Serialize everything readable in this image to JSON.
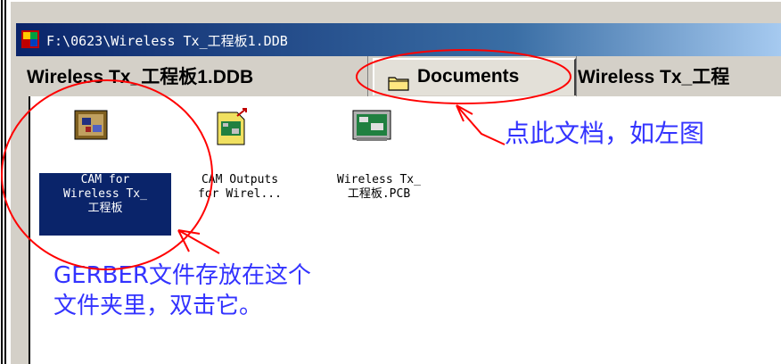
{
  "window": {
    "title": "F:\\0623\\Wireless Tx_工程板1.DDB"
  },
  "tabs": [
    {
      "label": "Wireless Tx_工程板1.DDB",
      "active": false
    },
    {
      "label": "Documents",
      "active": true,
      "icon": "folder-icon"
    },
    {
      "label": "Wireless Tx_工程",
      "active": false
    }
  ],
  "files": [
    {
      "label": "CAM for\nWireless Tx_\n工程板",
      "icon": "cam-folder-icon",
      "selected": true
    },
    {
      "label": "CAM Outputs\nfor Wirel...",
      "icon": "cam-outputs-icon",
      "selected": false
    },
    {
      "label": "Wireless Tx_\n工程板.PCB",
      "icon": "pcb-file-icon",
      "selected": false
    }
  ],
  "annotations": {
    "documents_note": "点此文档，如左图",
    "gerber_note_line1": "GERBER文件存放在这个",
    "gerber_note_line2": "文件夹里，双击它。"
  },
  "colors": {
    "annotation_text": "#3333ff",
    "annotation_marks": "#ff0000",
    "title_bar_start": "#0a246a",
    "selection_background": "#0a246a"
  }
}
